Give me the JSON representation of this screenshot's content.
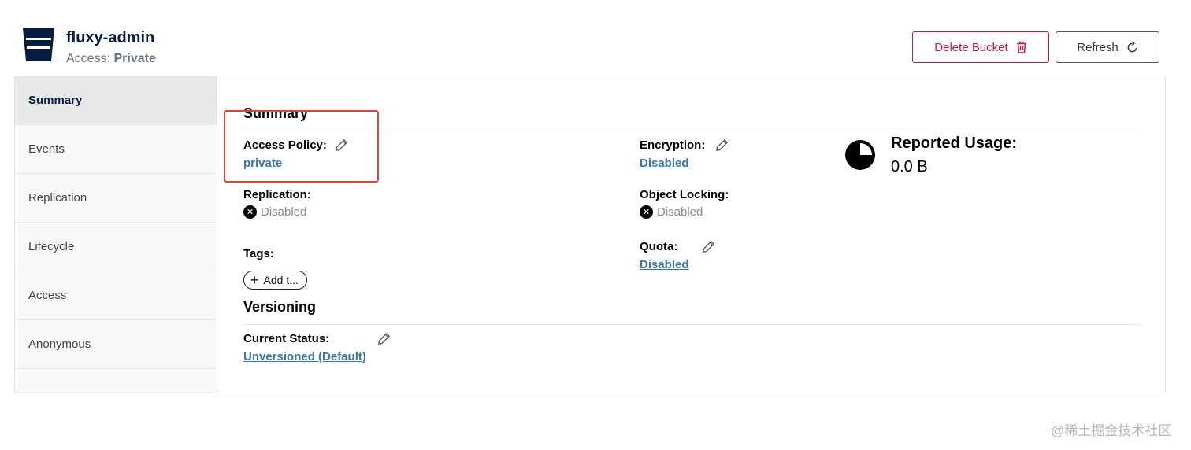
{
  "header": {
    "bucket_name": "fluxy-admin",
    "access_label": "Access:",
    "access_value": "Private",
    "delete_button": "Delete Bucket",
    "refresh_button": "Refresh"
  },
  "sidebar": {
    "items": [
      {
        "label": "Summary",
        "active": true
      },
      {
        "label": "Events"
      },
      {
        "label": "Replication"
      },
      {
        "label": "Lifecycle"
      },
      {
        "label": "Access"
      },
      {
        "label": "Anonymous"
      }
    ]
  },
  "summary": {
    "title": "Summary",
    "access_policy_label": "Access Policy:",
    "access_policy_value": "private",
    "encryption_label": "Encryption:",
    "encryption_value": "Disabled",
    "replication_label": "Replication:",
    "replication_value": "Disabled",
    "object_locking_label": "Object Locking:",
    "object_locking_value": "Disabled",
    "tags_label": "Tags:",
    "add_tag_label": "Add t...",
    "quota_label": "Quota:",
    "quota_value": "Disabled",
    "reported_usage_label": "Reported Usage:",
    "reported_usage_value": "0.0 B"
  },
  "versioning": {
    "title": "Versioning",
    "current_status_label": "Current Status:",
    "current_status_value": "Unversioned (Default)"
  },
  "watermark": "@稀土掘金技术社区",
  "colors": {
    "brand_navy": "#081c42",
    "danger": "#c51b3c",
    "link": "#3a76a8",
    "highlight": "#e0452f"
  }
}
